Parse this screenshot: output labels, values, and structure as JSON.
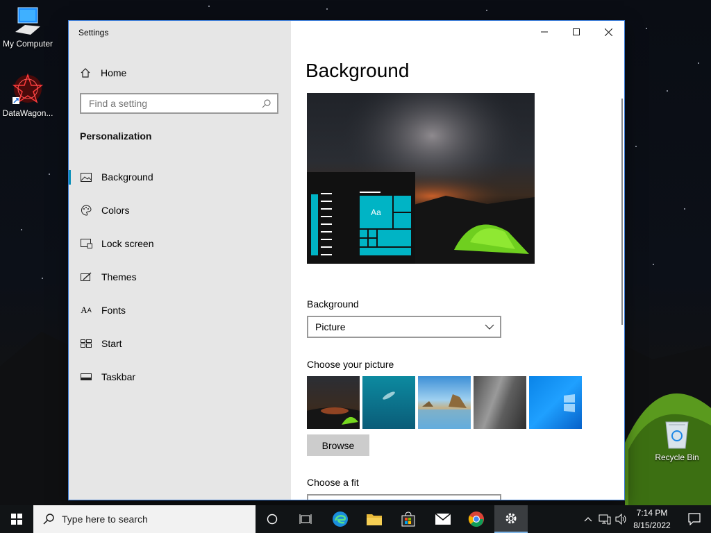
{
  "desktop": {
    "icons": [
      {
        "label": "My Computer"
      },
      {
        "label": "DataWagon..."
      },
      {
        "label": "Recycle Bin"
      }
    ]
  },
  "window": {
    "title": "Settings",
    "minimize_icon": "minimize-icon",
    "maximize_icon": "maximize-icon",
    "close_icon": "close-icon"
  },
  "nav": {
    "home_label": "Home",
    "search_placeholder": "Find a setting",
    "section_title": "Personalization",
    "items": [
      {
        "label": "Background",
        "icon": "image-icon",
        "active": true
      },
      {
        "label": "Colors",
        "icon": "palette-icon",
        "active": false
      },
      {
        "label": "Lock screen",
        "icon": "lock-screen-icon",
        "active": false
      },
      {
        "label": "Themes",
        "icon": "themes-icon",
        "active": false
      },
      {
        "label": "Fonts",
        "icon": "fonts-icon",
        "active": false
      },
      {
        "label": "Start",
        "icon": "start-icon",
        "active": false
      },
      {
        "label": "Taskbar",
        "icon": "taskbar-icon",
        "active": false
      }
    ]
  },
  "main": {
    "title": "Background",
    "preview_tile_text": "Aa",
    "background_label": "Background",
    "background_value": "Picture",
    "choose_picture_label": "Choose your picture",
    "browse_label": "Browse",
    "choose_fit_label": "Choose a fit"
  },
  "taskbar": {
    "search_placeholder": "Type here to search",
    "time": "7:14 PM",
    "date": "8/15/2022",
    "apps": [
      "start-icon",
      "task-view-icon",
      "edge-icon",
      "file-explorer-icon",
      "store-icon",
      "mail-icon",
      "chrome-icon",
      "settings-icon"
    ]
  },
  "colors": {
    "accent": "#0a8fb8",
    "tile": "#00b4c5",
    "nav_bg": "#e6e6e6"
  }
}
